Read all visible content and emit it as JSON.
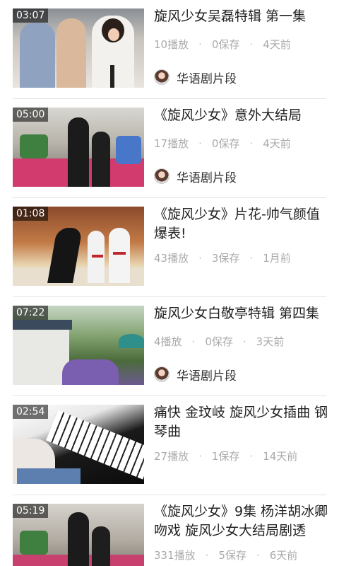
{
  "videos": [
    {
      "duration": "03:07",
      "title": "旋风少女吴磊特辑 第一集",
      "plays": "10播放",
      "saves": "0保存",
      "time": "4天前",
      "channel": "华语剧片段"
    },
    {
      "duration": "05:00",
      "title": "《旋风少女》意外大结局",
      "plays": "17播放",
      "saves": "0保存",
      "time": "4天前",
      "channel": "华语剧片段"
    },
    {
      "duration": "01:08",
      "title": "《旋风少女》片花-帅气颜值爆表!",
      "plays": "43播放",
      "saves": "3保存",
      "time": "1月前",
      "channel": ""
    },
    {
      "duration": "07:22",
      "title": "旋风少女白敬亭特辑 第四集",
      "plays": "4播放",
      "saves": "0保存",
      "time": "3天前",
      "channel": "华语剧片段"
    },
    {
      "duration": "02:54",
      "title": "痛快 金玟岐 旋风少女插曲 钢琴曲",
      "plays": "27播放",
      "saves": "1保存",
      "time": "14天前",
      "channel": ""
    },
    {
      "duration": "05:19",
      "title": "《旋风少女》9集 杨洋胡冰卿吻戏 旋风少女大结局剧透",
      "plays": "331播放",
      "saves": "5保存",
      "time": "6天前",
      "channel": ""
    }
  ],
  "icons": {
    "separator": "·",
    "avatar": "channel-avatar-icon"
  }
}
